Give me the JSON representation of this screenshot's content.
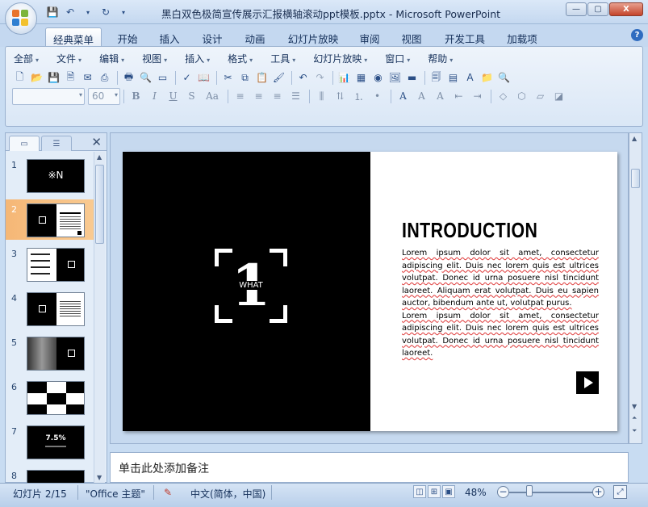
{
  "window": {
    "title": "黑白双色极简宣传展示汇报横轴滚动ppt模板.pptx - Microsoft PowerPoint",
    "minimize": "—",
    "maximize": "▢",
    "close": "X"
  },
  "quick_access": [
    "save-icon",
    "undo-icon",
    "redo-icon",
    "customize-icon"
  ],
  "ribbon_tabs": [
    "经典菜单",
    "开始",
    "插入",
    "设计",
    "动画",
    "幻灯片放映",
    "审阅",
    "视图",
    "开发工具",
    "加载项"
  ],
  "menu_bar": [
    "全部",
    "文件",
    "编辑",
    "视图",
    "插入",
    "格式",
    "工具",
    "幻灯片放映",
    "窗口",
    "帮助"
  ],
  "font_box": {
    "name": "",
    "size": "60"
  },
  "font_buttons": [
    "B",
    "I",
    "U",
    "S",
    "Aa"
  ],
  "slide_panel": {
    "thumbnails": [
      {
        "number": "1",
        "label": "※N"
      },
      {
        "number": "2",
        "label": ""
      },
      {
        "number": "3",
        "label": ""
      },
      {
        "number": "4",
        "label": ""
      },
      {
        "number": "5",
        "label": ""
      },
      {
        "number": "6",
        "label": ""
      },
      {
        "number": "7",
        "label": "7.5%"
      },
      {
        "number": "8",
        "label": ""
      }
    ],
    "selected_slide": 2
  },
  "slide": {
    "number_big": "1",
    "what_label": "WHAT",
    "title": "INTRODUCTION",
    "body_1": "Lorem ipsum dolor sit amet, consectetur adipiscing elit. Duis nec lorem quis est ultrices volutpat. Donec id urna posuere nisl tincidunt laoreet. Aliquam erat volutpat. Duis eu sapien auctor, bibendum ante ut, volutpat purus.",
    "body_2": "Lorem ipsum dolor sit amet, consectetur adipiscing elit. Duis nec lorem quis est ultrices volutpat. Donec id urna posuere nisl tincidunt laoreet."
  },
  "notes_placeholder": "单击此处添加备注",
  "status": {
    "slide_info": "幻灯片 2/15",
    "theme": "\"Office 主题\"",
    "language": "中文(简体，中国)",
    "zoom": "48%"
  }
}
